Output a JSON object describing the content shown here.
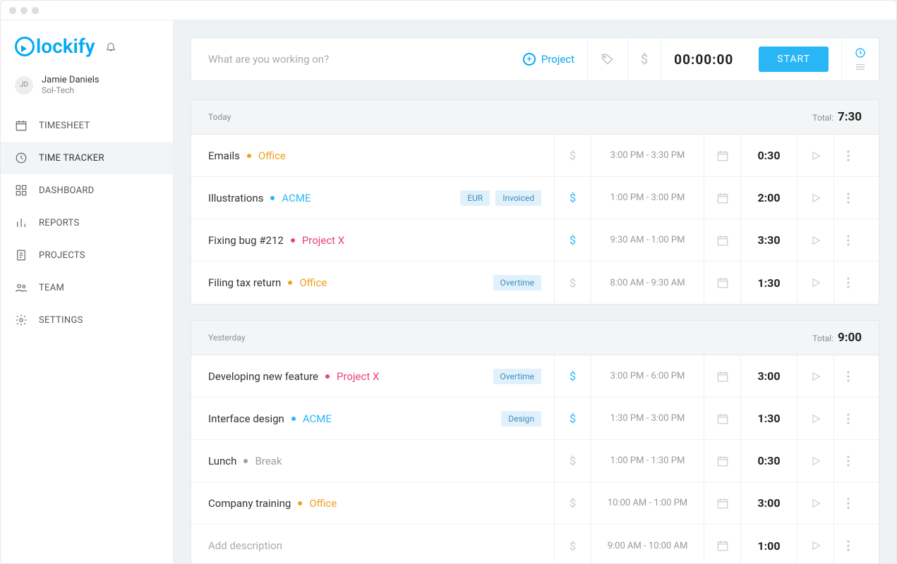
{
  "brand": "lockify",
  "user": {
    "initials": "JD",
    "name": "Jamie Daniels",
    "org": "Sol-Tech"
  },
  "nav": [
    {
      "id": "timesheet",
      "label": "TIMESHEET"
    },
    {
      "id": "timetracker",
      "label": "TIME TRACKER"
    },
    {
      "id": "dashboard",
      "label": "DASHBOARD"
    },
    {
      "id": "reports",
      "label": "REPORTS"
    },
    {
      "id": "projects",
      "label": "PROJECTS"
    },
    {
      "id": "team",
      "label": "TEAM"
    },
    {
      "id": "settings",
      "label": "SETTINGS"
    }
  ],
  "tracker": {
    "placeholder": "What are you working on?",
    "project_label": "Project",
    "timer": "00:00:00",
    "start_label": "START"
  },
  "projects": {
    "office": {
      "name": "Office",
      "color": "#f0a11f"
    },
    "acme": {
      "name": "ACME",
      "color": "#29b6f6"
    },
    "projectx": {
      "name": "Project X",
      "color": "#ec407a"
    },
    "break": {
      "name": "Break",
      "color": "#9aa0a6"
    }
  },
  "groups": [
    {
      "label": "Today",
      "total_label": "Total:",
      "total": "7:30",
      "entries": [
        {
          "title": "Emails",
          "project": "office",
          "tags": [],
          "billable": false,
          "range": "3:00 PM - 3:30 PM",
          "duration": "0:30"
        },
        {
          "title": "Illustrations",
          "project": "acme",
          "tags": [
            "EUR",
            "Invoiced"
          ],
          "billable": true,
          "range": "1:00 PM - 3:00 PM",
          "duration": "2:00"
        },
        {
          "title": "Fixing bug #212",
          "project": "projectx",
          "tags": [],
          "billable": true,
          "range": "9:30 AM - 1:00 PM",
          "duration": "3:30"
        },
        {
          "title": "Filing tax return",
          "project": "office",
          "tags": [
            "Overtime"
          ],
          "billable": false,
          "range": "8:00 AM - 9:30 AM",
          "duration": "1:30"
        }
      ]
    },
    {
      "label": "Yesterday",
      "total_label": "Total:",
      "total": "9:00",
      "entries": [
        {
          "title": "Developing new feature",
          "project": "projectx",
          "tags": [
            "Overtime"
          ],
          "billable": true,
          "range": "3:00 PM - 6:00 PM",
          "duration": "3:00"
        },
        {
          "title": "Interface design",
          "project": "acme",
          "tags": [
            "Design"
          ],
          "billable": true,
          "range": "1:30 PM - 3:00 PM",
          "duration": "1:30"
        },
        {
          "title": "Lunch",
          "project": "break",
          "tags": [],
          "billable": false,
          "range": "1:00 PM - 1:30 PM",
          "duration": "0:30"
        },
        {
          "title": "Company training",
          "project": "office",
          "tags": [],
          "billable": false,
          "range": "10:00 AM - 1:00 PM",
          "duration": "3:00"
        },
        {
          "title": "",
          "placeholder": "Add description",
          "project": null,
          "tags": [],
          "billable": false,
          "range": "9:00 AM - 10:00 AM",
          "duration": "1:00"
        }
      ]
    }
  ]
}
